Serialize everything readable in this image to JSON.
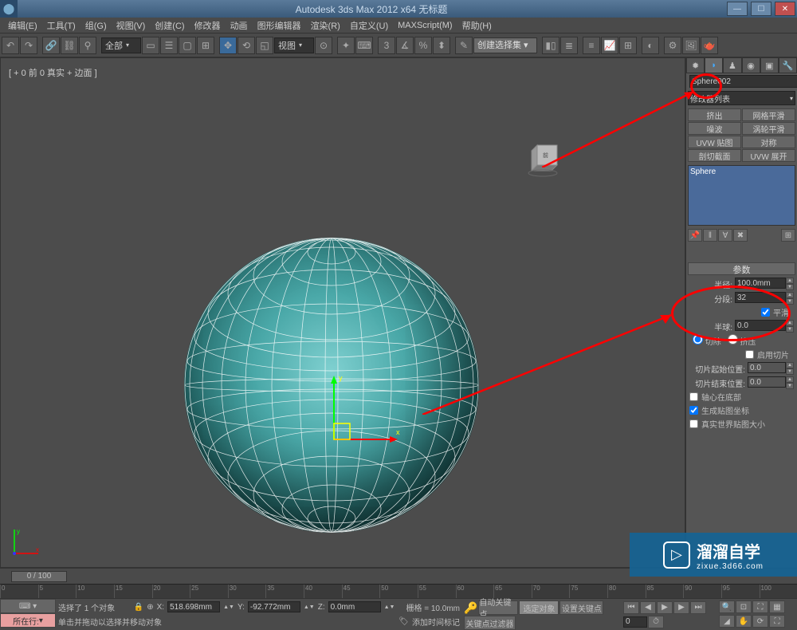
{
  "title": "Autodesk 3ds Max 2012 x64    无标题",
  "menu": [
    "编辑(E)",
    "工具(T)",
    "组(G)",
    "视图(V)",
    "创建(C)",
    "修改器",
    "动画",
    "图形编辑器",
    "渲染(R)",
    "自定义(U)",
    "MAXScript(M)",
    "帮助(H)"
  ],
  "toolbar": {
    "dropdown_all": "全部",
    "dropdown_view": "视图",
    "selection_set": "创建选择集"
  },
  "viewport": {
    "label": "[ + 0 前 0 真实 + 边面 ]"
  },
  "cmdpanel": {
    "object_name": "Sphere002",
    "modifier_list": "修改器列表",
    "mod_buttons": [
      "挤出",
      "网格平滑",
      "噪波",
      "涡轮平滑",
      "UVW 贴图",
      "对称",
      "剖切截面",
      "UVW 展开"
    ],
    "stack_item": "Sphere",
    "rollout_title": "参数",
    "radius_label": "半径:",
    "radius_value": "100.0mm",
    "segments_label": "分段:",
    "segments_value": "32",
    "smooth_label": "平滑",
    "hemisphere_label": "半球:",
    "hemisphere_value": "0.0",
    "chop_label": "切除",
    "squash_label": "挤压",
    "slice_on_label": "启用切片",
    "slice_from_label": "切片起始位置:",
    "slice_from_value": "0.0",
    "slice_to_label": "切片结束位置:",
    "slice_to_value": "0.0",
    "base_pivot_label": "轴心在底部",
    "gen_uv_label": "生成贴图坐标",
    "real_world_label": "真实世界贴图大小"
  },
  "timeline": {
    "slider": "0 / 100",
    "ticks": [
      "0",
      "5",
      "10",
      "15",
      "20",
      "25",
      "30",
      "35",
      "40",
      "45",
      "50",
      "55",
      "60",
      "65",
      "70",
      "75",
      "80",
      "85",
      "90",
      "95",
      "100"
    ]
  },
  "status": {
    "selected": "选择了 1 个对象",
    "hint": "单击并拖动以选择并移动对象",
    "add_time_tag": "添加时间标记",
    "location": "所在行:",
    "x": "518.698mm",
    "y": "-92.772mm",
    "z": "0.0mm",
    "grid": "栅格 = 10.0mm",
    "auto_key": "自动关键点",
    "sel_lock": "选定对象",
    "set_key": "设置关键点",
    "key_filter": "关键点过滤器"
  },
  "watermark": {
    "big": "溜溜自学",
    "small": "zixue.3d66.com"
  }
}
